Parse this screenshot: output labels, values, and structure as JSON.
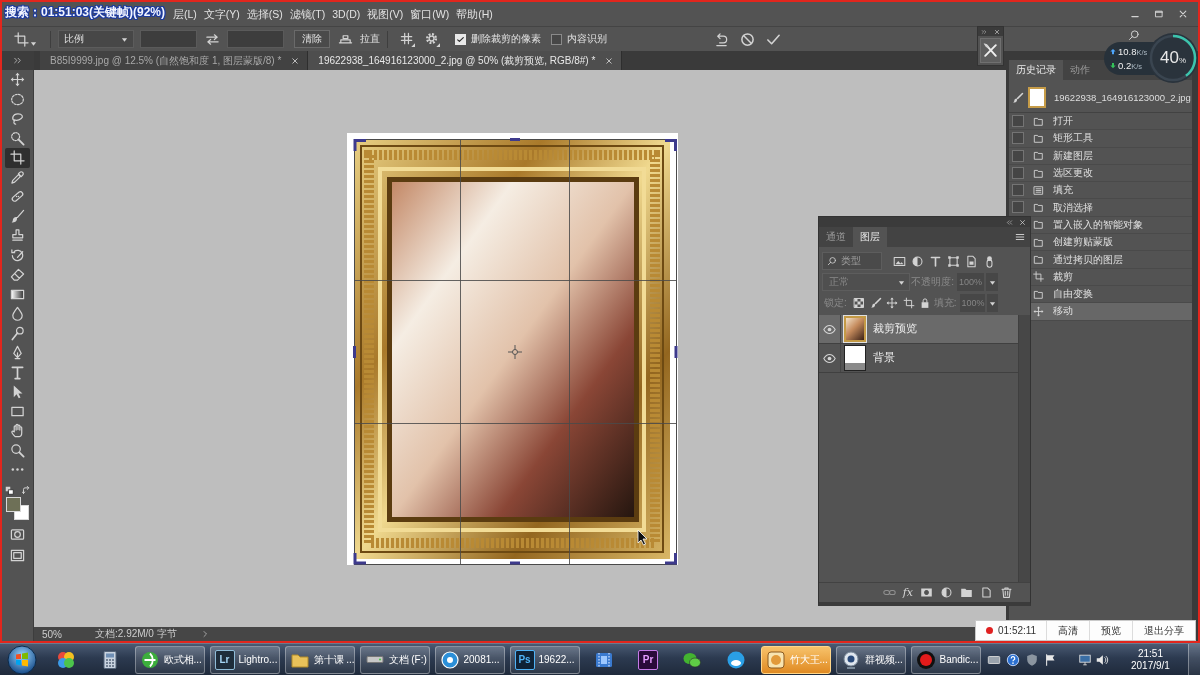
{
  "video_overlay": {
    "text": "搜索：01:51:03(关键帧)(92%)"
  },
  "menu_bar": {
    "items": [
      "层(L)",
      "文字(Y)",
      "选择(S)",
      "滤镜(T)",
      "3D(D)",
      "视图(V)",
      "窗口(W)",
      "帮助(H)"
    ]
  },
  "options_bar": {
    "ratio_dropdown": {
      "value": "比例"
    },
    "clear_button": "清除",
    "straighten_button": "拉直",
    "checkboxes": [
      {
        "label": "删除裁剪的像素",
        "checked": true
      },
      {
        "label": "内容识别",
        "checked": false
      }
    ]
  },
  "network_monitor": {
    "upload": {
      "value": "10.8",
      "unit": "K/s"
    },
    "download": {
      "value": "0.2",
      "unit": "K/s"
    },
    "load": {
      "value": "40",
      "unit": "%"
    },
    "level": 0.4
  },
  "document_tabs": [
    {
      "label": "B85I9999.jpg @ 12.5% (自然饱和度 1, 图层蒙版/8) *",
      "selected": false
    },
    {
      "label": "19622938_164916123000_2.jpg @ 50% (裁剪预览, RGB/8#) *",
      "selected": true
    }
  ],
  "tools": [
    {
      "selected": false
    },
    {
      "selected": false
    },
    {
      "selected": false
    },
    {
      "selected": false
    },
    {
      "selected": true
    },
    {
      "selected": false
    },
    {
      "selected": false
    },
    {
      "selected": false
    },
    {
      "selected": false
    },
    {
      "selected": false
    },
    {
      "selected": false
    },
    {
      "selected": false
    },
    {
      "selected": false
    },
    {
      "selected": false
    },
    {
      "selected": false
    },
    {
      "selected": false
    },
    {
      "selected": false
    },
    {
      "selected": false
    },
    {
      "selected": false
    },
    {
      "selected": false
    },
    {
      "selected": false
    }
  ],
  "color_swatches": [
    {
      "color": "#6e7057"
    },
    {
      "color": "#ffffff"
    }
  ],
  "status_bar": {
    "zoom": "50%",
    "document_info": "文档:2.92M/0 字节"
  },
  "history_panel": {
    "tabs": [
      {
        "label": "历史记录",
        "selected": true
      },
      {
        "label": "动作",
        "selected": false
      }
    ],
    "snapshot": "19622938_164916123000_2.jpg",
    "items": [
      {
        "label": "打开",
        "kind": "document",
        "selected": false
      },
      {
        "label": "矩形工具",
        "kind": "document",
        "selected": false
      },
      {
        "label": "新建图层",
        "kind": "document",
        "selected": false
      },
      {
        "label": "选区更改",
        "kind": "document",
        "selected": false
      },
      {
        "label": "填充",
        "kind": "fill",
        "selected": false
      },
      {
        "label": "取消选择",
        "kind": "document",
        "selected": false
      },
      {
        "label": "置入嵌入的智能对象",
        "kind": "document",
        "selected": false
      },
      {
        "label": "创建剪贴蒙版",
        "kind": "document",
        "selected": false
      },
      {
        "label": "通过拷贝的图层",
        "kind": "document",
        "selected": false
      },
      {
        "label": "裁剪",
        "kind": "crop",
        "selected": false
      },
      {
        "label": "自由变换",
        "kind": "document",
        "selected": false
      },
      {
        "label": "移动",
        "kind": "move",
        "selected": true
      }
    ]
  },
  "layers_panel": {
    "tabs": [
      {
        "label": "通道",
        "selected": false
      },
      {
        "label": "图层",
        "selected": true
      }
    ],
    "filter": {
      "value": "类型"
    },
    "blend_mode": {
      "value": "正常",
      "disabled": true
    },
    "opacity": {
      "label": "不透明度:",
      "value": "100%",
      "disabled": true
    },
    "lock_label": "锁定:",
    "fill": {
      "label": "填充:",
      "value": "100%",
      "disabled": true
    },
    "layers": [
      {
        "name": "裁剪预览",
        "kind": "photo",
        "visible": true,
        "selected": true
      },
      {
        "name": "背景",
        "kind": "blank",
        "visible": true,
        "selected": false
      }
    ],
    "footer_fx": "fx"
  },
  "share_bar": {
    "time": "01:52:11",
    "buttons": [
      "高清",
      "预览",
      "退出分享"
    ]
  },
  "taskbar": {
    "items": [
      {
        "kind": "icon"
      },
      {
        "kind": "icon"
      },
      {
        "kind": "window",
        "label": "欧式相...",
        "highlighted": false
      },
      {
        "kind": "window",
        "label": "Lightro...",
        "logo": "Lr",
        "highlighted": false
      },
      {
        "kind": "window",
        "label": "第十课 ...",
        "highlighted": false
      },
      {
        "kind": "window",
        "label": "文档 (F:)",
        "highlighted": false
      },
      {
        "kind": "window",
        "label": "20081...",
        "highlighted": false
      },
      {
        "kind": "window",
        "label": "19622...",
        "logo": "Ps",
        "highlighted": false
      },
      {
        "kind": "icon"
      },
      {
        "kind": "icon",
        "logo": "Pr"
      },
      {
        "kind": "icon"
      },
      {
        "kind": "icon"
      },
      {
        "kind": "window",
        "label": "竹大王...",
        "highlighted": true
      },
      {
        "kind": "window",
        "label": "群视频...",
        "highlighted": false
      },
      {
        "kind": "window",
        "label": "Bandic...",
        "highlighted": false
      }
    ],
    "clock": {
      "time": "21:51",
      "date": "2017/9/1"
    }
  }
}
